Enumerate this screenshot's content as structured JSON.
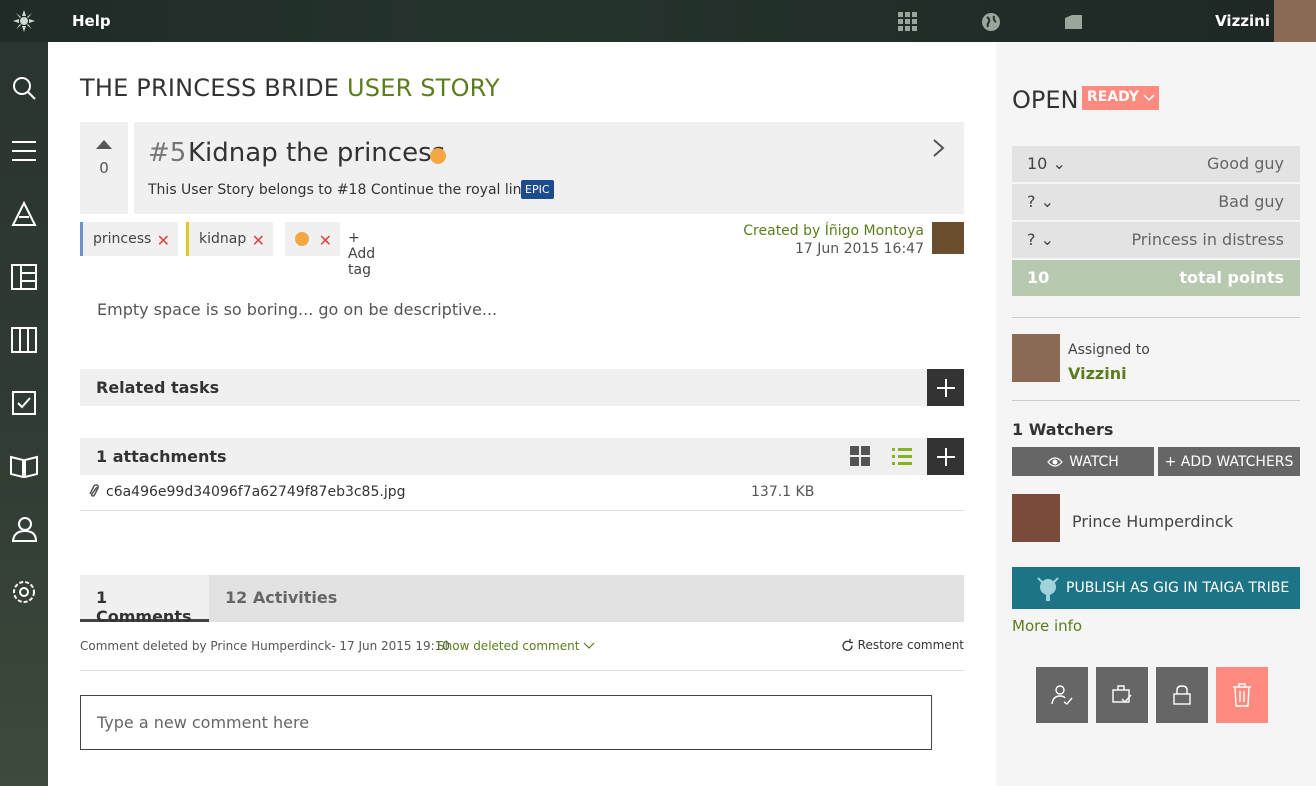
{
  "topbar": {
    "help": "Help",
    "username": "Vizzini"
  },
  "page": {
    "project": "THE PRINCESS BRIDE",
    "type": "USER STORY"
  },
  "story": {
    "votes": "0",
    "ref": "#5",
    "subject": "Kidnap the princess",
    "belongs_text": "This User Story belongs to",
    "epic_link": "#18 Continue the royal line",
    "epic_badge": "EPIC",
    "created_by": "Created by Íñigo Montoya",
    "created_date": "17 Jun 2015 16:47",
    "description_placeholder": "Empty space is so boring... go on be descriptive..."
  },
  "tags": [
    {
      "label": "princess",
      "color": "#6a93c7"
    },
    {
      "label": "kidnap",
      "color": "#e3c920"
    }
  ],
  "add_tag": "Add tag",
  "related_tasks": "Related tasks",
  "attachments": {
    "title": "1 attachments",
    "files": [
      {
        "name": "c6a496e99d34096f7a62749f87eb3c85.jpg",
        "size": "137.1 KB"
      }
    ]
  },
  "tabs": {
    "comments": "1 Comments",
    "activities": "12 Activities"
  },
  "comment": {
    "deleted_text": "Comment deleted by Prince Humperdinck- 17 Jun 2015 19:10",
    "show_deleted": "Show deleted comment",
    "restore": "Restore comment",
    "input_placeholder": "Type a new comment here"
  },
  "sidebar_right": {
    "status": "OPEN",
    "ready_badge": "READY",
    "points": [
      {
        "value": "10",
        "role": "Good guy"
      },
      {
        "value": "?",
        "role": "Bad guy"
      },
      {
        "value": "?",
        "role": "Princess in distress"
      }
    ],
    "total": {
      "value": "10",
      "label": "total points"
    },
    "assigned_label": "Assigned to",
    "assigned_name": "Vizzini",
    "watchers_title": "1 Watchers",
    "watch_btn": "WATCH",
    "add_watchers_btn": "+ ADD WATCHERS",
    "watcher_name": "Prince Humperdinck",
    "publish_btn": "PUBLISH AS GIG IN TAIGA TRIBE",
    "more_info": "More info"
  },
  "colors": {
    "accent": "#5b7d1e",
    "ready": "#ff8a80",
    "publish": "#1d7486",
    "epic": "#1c4c8c"
  }
}
